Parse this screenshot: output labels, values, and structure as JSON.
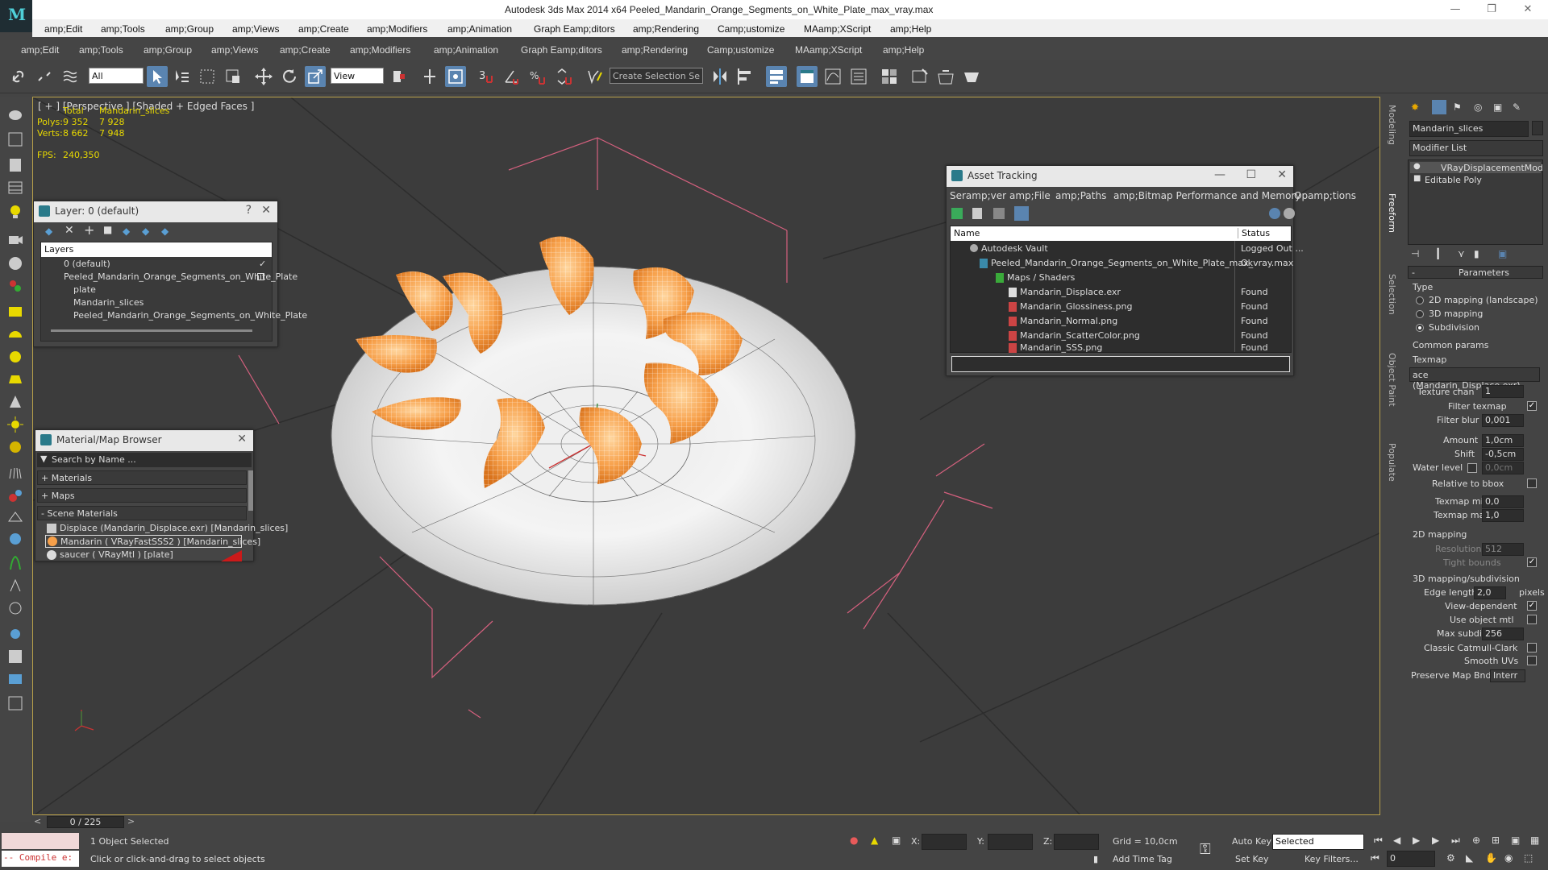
{
  "window": {
    "title": "Autodesk 3ds Max  2014 x64    Peeled_Mandarin_Orange_Segments_on_White_Plate_max_vray.max",
    "minimize": "—",
    "restore": "❐",
    "close": "✕"
  },
  "menu_top": [
    "amp;Edit",
    "amp;Tools",
    "amp;Group",
    "amp;Views",
    "amp;Create",
    "amp;Modifiers",
    "amp;Animation",
    "Graph Eamp;ditors",
    "amp;Rendering",
    "Camp;ustomize",
    "MAamp;XScript",
    "amp;Help"
  ],
  "menu_main": [
    "amp;Edit",
    "amp;Tools",
    "amp;Group",
    "amp;Views",
    "amp;Create",
    "amp;Modifiers",
    "amp;Animation",
    "Graph Eamp;ditors",
    "amp;Rendering",
    "Camp;ustomize",
    "MAamp;XScript",
    "amp;Help"
  ],
  "toolbar": {
    "filter_value": "All",
    "view_value": "View",
    "selection_set_placeholder": "Create Selection Se"
  },
  "viewport": {
    "label": "[ + ] [Perspective ] [Shaded + Edged Faces ]",
    "stats": {
      "header_total": "Total",
      "header_object": "Mandarin_slices",
      "polys_label": "Polys:",
      "polys_total": "9 352",
      "polys_obj": "7 928",
      "verts_label": "Verts:",
      "verts_total": "8 662",
      "verts_obj": "7 948",
      "fps_label": "FPS:",
      "fps_value": "240,350"
    }
  },
  "layer_window": {
    "title": "Layer: 0 (default)",
    "help": "?",
    "close": "✕",
    "column": "Layers",
    "rows": [
      {
        "label": "0 (default)"
      },
      {
        "label": "Peeled_Mandarin_Orange_Segments_on_White_Plate"
      },
      {
        "label": "plate"
      },
      {
        "label": "Mandarin_slices"
      },
      {
        "label": "Peeled_Mandarin_Orange_Segments_on_White_Plate"
      }
    ]
  },
  "material_browser": {
    "title": "Material/Map Browser",
    "close": "✕",
    "search_placeholder": "Search by Name ...",
    "sections": [
      "+ Materials",
      "+ Maps",
      "- Scene Materials"
    ],
    "items": [
      "Displace (Mandarin_Displace.exr) [Mandarin_slices]",
      "Mandarin  ( VRayFastSSS2 ) [Mandarin_slices]",
      "saucer  ( VRayMtl ) [plate]"
    ]
  },
  "asset_tracking": {
    "title": "Asset Tracking",
    "menu": [
      "Seramp;ver",
      "amp;File",
      "amp;Paths",
      "amp;Bitmap Performance and Memory",
      "Opamp;tions"
    ],
    "col_name": "Name",
    "col_status": "Status",
    "rows": [
      {
        "name": "Autodesk Vault",
        "status": "Logged Out ..."
      },
      {
        "name": "Peeled_Mandarin_Orange_Segments_on_White_Plate_max_vray.max",
        "status": "Ok"
      },
      {
        "name": "Maps / Shaders",
        "status": ""
      },
      {
        "name": "Mandarin_Displace.exr",
        "status": "Found"
      },
      {
        "name": "Mandarin_Glossiness.png",
        "status": "Found"
      },
      {
        "name": "Mandarin_Normal.png",
        "status": "Found"
      },
      {
        "name": "Mandarin_ScatterColor.png",
        "status": "Found"
      },
      {
        "name": "Mandarin_SSS.png",
        "status": "Found"
      }
    ]
  },
  "side_tabs": [
    "Modeling",
    "Freeform",
    "Selection",
    "Object Paint",
    "Populate"
  ],
  "command_panel": {
    "object_name": "Mandarin_slices",
    "modifier_list": "Modifier List",
    "stack": [
      "VRayDisplacementMod",
      "Editable Poly"
    ],
    "rollout": "Parameters",
    "type_label": "Type",
    "type_options": [
      "2D mapping (landscape)",
      "3D mapping",
      "Subdivision"
    ],
    "common_params": "Common params",
    "texmap_label": "Texmap",
    "texmap_value": "ace (Mandarin_Displace.exr)",
    "texture_chan_label": "Texture chan",
    "texture_chan": "1",
    "filter_texmap": "Filter texmap",
    "filter_blur_label": "Filter blur",
    "filter_blur": "0,001",
    "amount_label": "Amount",
    "amount": "1,0cm",
    "shift_label": "Shift",
    "shift": "-0,5cm",
    "water_level_label": "Water level",
    "water_level": "0,0cm",
    "relative_bbox": "Relative to bbox",
    "texmap_min_label": "Texmap min",
    "texmap_min": "0,0",
    "texmap_max_label": "Texmap max",
    "texmap_max": "1,0",
    "mapping_2d": "2D mapping",
    "resolution_label": "Resolution",
    "resolution": "512",
    "tight_bounds": "Tight bounds",
    "mapping_3d": "3D mapping/subdivision",
    "edge_length_label": "Edge length",
    "edge_length": "2,0",
    "pixels": "pixels",
    "view_dependent": "View-dependent",
    "use_object_mtl": "Use object mtl",
    "max_subdivs_label": "Max subdivs",
    "max_subdivs": "256",
    "classic_catmull": "Classic Catmull-Clark",
    "smooth_uvs": "Smooth UVs",
    "preserve_map_bnd_label": "Preserve Map Bnd",
    "preserve_map_bnd": "Interr"
  },
  "timeline": {
    "frame": "0 / 225"
  },
  "status": {
    "compile": "-- Compile e:",
    "selected": "1 Object Selected",
    "prompt": "Click or click-and-drag to select objects",
    "x_label": "X:",
    "y_label": "Y:",
    "z_label": "Z:",
    "grid": "Grid = 10,0cm",
    "add_time_tag": "Add Time Tag",
    "auto_key": "Auto Key",
    "selected_value": "Selected",
    "set_key": "Set Key",
    "key_filters": "Key Filters...",
    "frame_value": "0"
  }
}
